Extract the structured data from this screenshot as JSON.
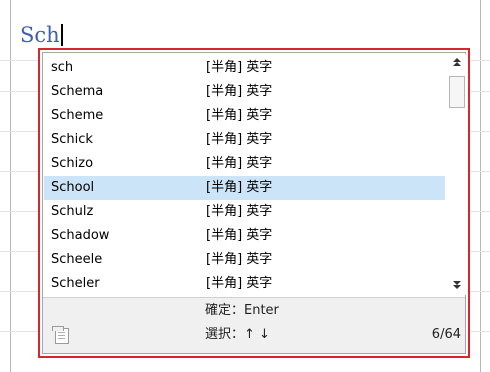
{
  "editor": {
    "typed_text": "Sch"
  },
  "ime_popup": {
    "candidates": [
      {
        "word": "sch",
        "type": "[半角] 英字"
      },
      {
        "word": "Schema",
        "type": "[半角] 英字"
      },
      {
        "word": "Scheme",
        "type": "[半角] 英字"
      },
      {
        "word": "Schick",
        "type": "[半角] 英字"
      },
      {
        "word": "Schizo",
        "type": "[半角] 英字"
      },
      {
        "word": "School",
        "type": "[半角] 英字"
      },
      {
        "word": "Schulz",
        "type": "[半角] 英字"
      },
      {
        "word": "Schadow",
        "type": "[半角] 英字"
      },
      {
        "word": "Scheele",
        "type": "[半角] 英字"
      },
      {
        "word": "Scheler",
        "type": "[半角] 英字"
      }
    ],
    "selected_word": "School",
    "scroll_up_icon": "scroll-up-arrow",
    "scroll_down_icon": "scroll-down-arrow",
    "footer": {
      "confirm_hint": "確定：Enter",
      "select_hint": "選択：↑ ↓",
      "page_count": "6/64",
      "icon": "dictionary-tool-icon"
    }
  },
  "colors": {
    "highlight_border": "#d7262c",
    "selected_row": "#cce4f7",
    "typed_text": "#3d5fb0"
  }
}
